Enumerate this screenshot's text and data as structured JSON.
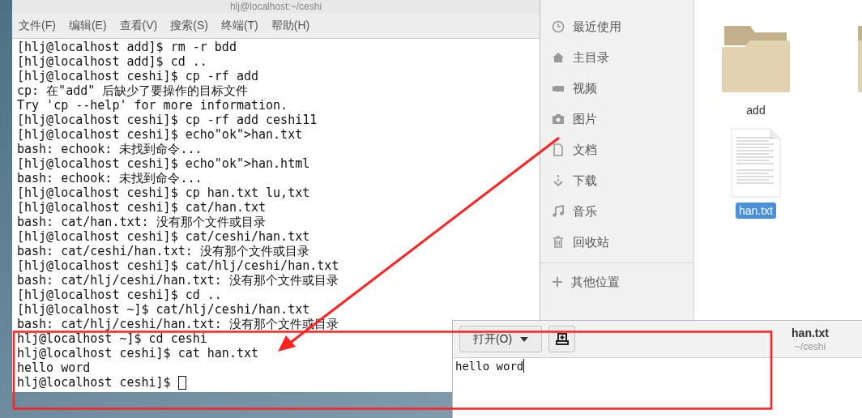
{
  "terminal": {
    "title": "hlj@localhost:~/ceshi",
    "menu": [
      "文件(F)",
      "编辑(E)",
      "查看(V)",
      "搜索(S)",
      "终端(T)",
      "帮助(H)"
    ],
    "lines": [
      "[hlj@localhost add]$ rm -r bdd",
      "[hlj@localhost add]$ cd ..",
      "[hlj@localhost ceshi]$ cp -rf add",
      "cp: 在\"add\" 后缺少了要操作的目标文件",
      "Try 'cp --help' for more information.",
      "[hlj@localhost ceshi]$ cp -rf add ceshi11",
      "[hlj@localhost ceshi]$ echo\"ok\">han.txt",
      "bash: echook: 未找到命令...",
      "[hlj@localhost ceshi]$ echo\"ok\">han.html",
      "bash: echook: 未找到命令...",
      "[hlj@localhost ceshi]$ cp han.txt lu,txt",
      "[hlj@localhost ceshi]$ cat/han.txt",
      "bash: cat/han.txt: 没有那个文件或目录",
      "[hlj@localhost ceshi]$ cat/ceshi/han.txt",
      "bash: cat/ceshi/han.txt: 没有那个文件或目录",
      "[hlj@localhost ceshi]$ cat/hlj/ceshi/han.txt",
      "bash: cat/hlj/ceshi/han.txt: 没有那个文件或目录",
      "[hlj@localhost ceshi]$ cd ..",
      "[hlj@localhost ~]$ cat/hlj/ceshi/han.txt",
      "bash: cat/hlj/ceshi/han.txt: 没有那个文件或目录",
      "hlj@localhost ~]$ cd ceshi",
      "hlj@localhost ceshi]$ cat han.txt",
      "hello word",
      "hlj@localhost ceshi]$ "
    ]
  },
  "file_manager": {
    "sidebar": {
      "items": [
        "最近使用",
        "主目录",
        "视频",
        "图片",
        "文档",
        "下载",
        "音乐",
        "回收站"
      ],
      "other": "其他位置"
    },
    "files": [
      {
        "name": "add",
        "kind": "folder",
        "selected": false
      },
      {
        "name": "han.txt",
        "kind": "document",
        "selected": true
      }
    ]
  },
  "editor": {
    "open_button": "打开(O)",
    "title": "han.txt",
    "subtitle": "~/ceshi",
    "content": "hello word"
  }
}
